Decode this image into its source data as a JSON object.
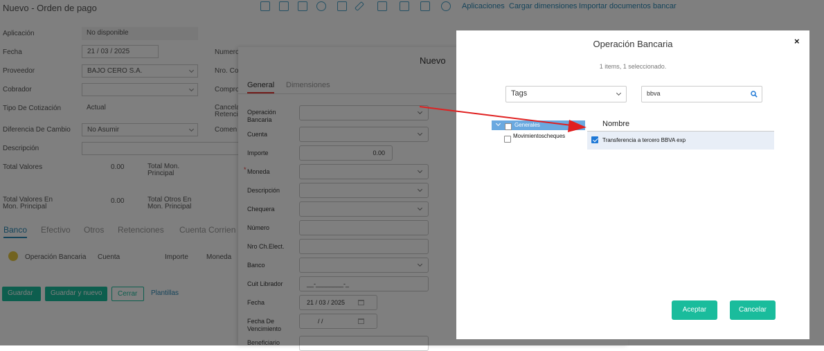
{
  "background": {
    "page_title": "Nuevo - Orden de pago",
    "toolbar_links": [
      "Aplicaciones",
      "Cargar dimensiones",
      "Importar documentos bancar"
    ],
    "left_form": [
      {
        "label": "Aplicación",
        "value": "No disponible"
      },
      {
        "label": "Fecha",
        "value": "21 / 03 / 2025"
      },
      {
        "label": "Proveedor",
        "value": "BAJO CERO S.A."
      },
      {
        "label": "Cobrador",
        "value": ""
      },
      {
        "label": "Tipo De Cotización",
        "value": "Actual"
      },
      {
        "label": "Diferencia De Cambio",
        "value": "No Asumir"
      },
      {
        "label": "Descripción",
        "value": ""
      }
    ],
    "right_form_labels": [
      "Numero",
      "Nro. Co",
      "Compro",
      "Cancela Retenció",
      "Comen"
    ],
    "totals": [
      {
        "label": "Total Valores",
        "value": "0.00",
        "label2": "Total Mon. Principal"
      },
      {
        "label": "Total Valores En Mon. Principal",
        "value": "0.00",
        "label2": "Total Otros En Mon. Principal"
      }
    ],
    "tabs": [
      "Banco",
      "Efectivo",
      "Otros",
      "Retenciones",
      "Cuenta Corrien"
    ],
    "grid_headers": [
      "Operación Bancaria",
      "Cuenta",
      "Importe",
      "Moneda"
    ],
    "buttons": {
      "save": "Guardar",
      "save_new": "Guardar y nuevo",
      "close": "Cerrar",
      "templates": "Plantillas"
    }
  },
  "nuevo_panel": {
    "title": "Nuevo",
    "tabs": {
      "general": "General",
      "dimensions": "Dimensiones"
    },
    "fields": [
      {
        "label": "Operación Bancaria",
        "value": "",
        "type": "select"
      },
      {
        "label": "Cuenta",
        "value": "",
        "type": "select"
      },
      {
        "label": "Importe",
        "value": "0.00",
        "type": "number"
      },
      {
        "label": "Moneda",
        "value": "",
        "type": "select",
        "required": true
      },
      {
        "label": "Descripción",
        "value": "",
        "type": "select"
      },
      {
        "label": "Chequera",
        "value": "",
        "type": "select"
      },
      {
        "label": "Número",
        "value": "",
        "type": "text"
      },
      {
        "label": "Nro Ch.Elect.",
        "value": "",
        "type": "text"
      },
      {
        "label": "Banco",
        "value": "",
        "type": "select"
      },
      {
        "label": "Cuit Librador",
        "value": "__-________-_",
        "type": "text"
      },
      {
        "label": "Fecha",
        "value": "21 / 03 / 2025",
        "type": "date"
      },
      {
        "label": "Fecha De Vencimiento",
        "value": "/      /",
        "type": "date"
      },
      {
        "label": "Beneficiario",
        "value": "",
        "type": "text"
      }
    ]
  },
  "modal": {
    "title": "Operación Bancaria",
    "close_glyph": "×",
    "status": "1 items, 1 seleccionado.",
    "filter_select": "Tags",
    "search_value": "bbva",
    "tree": [
      {
        "label": "Generales",
        "selected": true
      },
      {
        "label": "Movimientoscheques",
        "selected": false
      }
    ],
    "column_header": "Nombre",
    "rows": [
      {
        "name": "Transferencia a tercero BBVA exp",
        "checked": true
      }
    ],
    "accept_label": "Aceptar",
    "cancel_label": "Cancelar"
  },
  "colors": {
    "accent_green": "#1abc9c",
    "annotation_arrow": "#e02020",
    "tree_highlight": "#6aa9e0"
  }
}
